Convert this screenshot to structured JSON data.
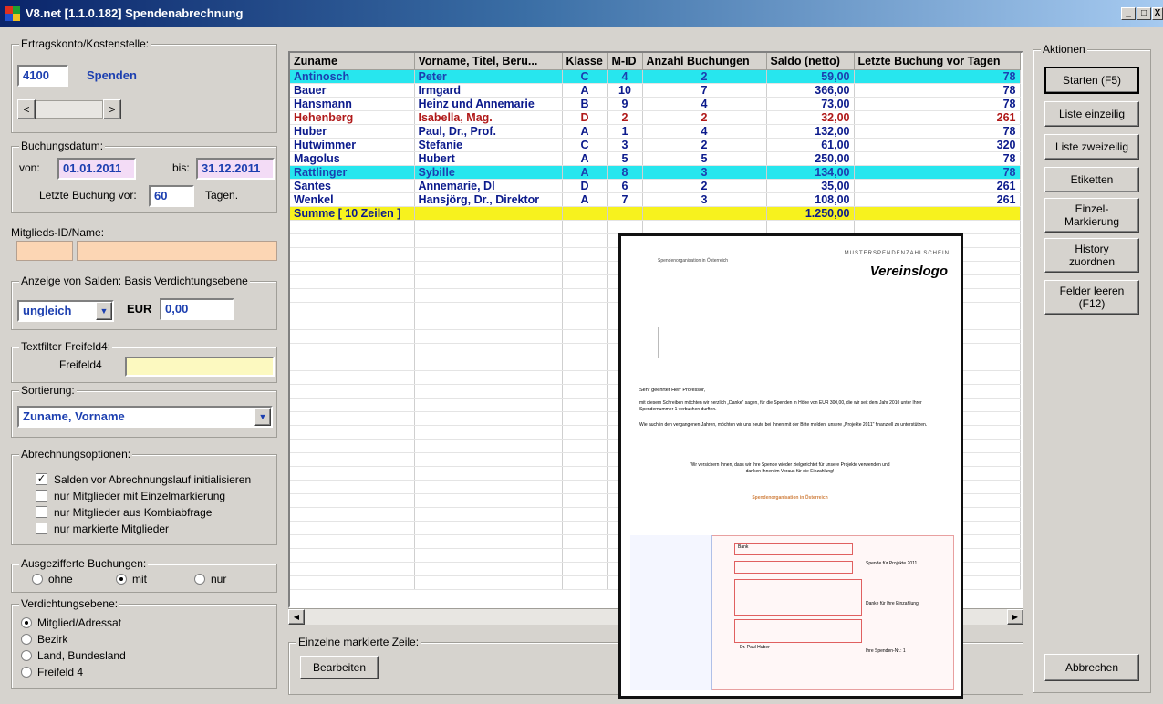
{
  "window": {
    "title": "V8.net [1.1.0.182] Spendenabrechnung",
    "min": "_",
    "max": "□",
    "close": "X"
  },
  "account": {
    "legend": "Ertragskonto/Kostenstelle:",
    "code": "4100",
    "name": "Spenden",
    "prev": "<",
    "next": ">"
  },
  "date": {
    "legend": "Buchungsdatum:",
    "von_label": "von:",
    "von": "01.01.2011",
    "bis_label": "bis:",
    "bis": "31.12.2011",
    "last_label": "Letzte Buchung vor:",
    "last_value": "60",
    "tage_label": "Tagen."
  },
  "member": {
    "label": "Mitglieds-ID/Name:"
  },
  "saldo": {
    "legend": "Anzeige von Salden: Basis Verdichtungsebene",
    "select": "ungleich",
    "currency": "EUR",
    "value": "0,00"
  },
  "textfilter": {
    "legend": "Textfilter Freifeld4:",
    "label": "Freifeld4"
  },
  "sort": {
    "legend": "Sortierung:",
    "value": "Zuname, Vorname"
  },
  "options": {
    "legend": "Abrechnungsoptionen:",
    "items": [
      "Salden vor Abrechnungslauf initialisieren",
      "nur Mitglieder mit Einzelmarkierung",
      "nur Mitglieder aus Kombiabfrage",
      "nur markierte Mitglieder"
    ]
  },
  "ausgeziffert": {
    "legend": "Ausgezifferte Buchungen:",
    "ohne": "ohne",
    "mit": "mit",
    "nur": "nur"
  },
  "verdichtung": {
    "legend": "Verdichtungsebene:",
    "items": [
      "Mitglied/Adressat",
      "Bezirk",
      "Land, Bundesland",
      "Freifeld 4"
    ]
  },
  "table": {
    "columns": [
      "Zuname",
      "Vorname, Titel, Beru...",
      "Klasse",
      "M-ID",
      "Anzahl Buchungen",
      "Saldo (netto)",
      "Letzte Buchung vor Tagen"
    ],
    "rows": [
      [
        "Antinosch",
        "Peter",
        "C",
        "4",
        "2",
        "59,00",
        "78"
      ],
      [
        "Bauer",
        "Irmgard",
        "A",
        "10",
        "7",
        "366,00",
        "78"
      ],
      [
        "Hansmann",
        "Heinz und Annemarie",
        "B",
        "9",
        "4",
        "73,00",
        "78"
      ],
      [
        "Hehenberg",
        "Isabella, Mag.",
        "D",
        "2",
        "2",
        "32,00",
        "261"
      ],
      [
        "Huber",
        "Paul, Dr., Prof.",
        "A",
        "1",
        "4",
        "132,00",
        "78"
      ],
      [
        "Hutwimmer",
        "Stefanie",
        "C",
        "3",
        "2",
        "61,00",
        "320"
      ],
      [
        "Magolus",
        "Hubert",
        "A",
        "5",
        "5",
        "250,00",
        "78"
      ],
      [
        "Rattlinger",
        "Sybille",
        "A",
        "8",
        "3",
        "134,00",
        "78"
      ],
      [
        "Santes",
        "Annemarie, DI",
        "D",
        "6",
        "2",
        "35,00",
        "261"
      ],
      [
        "Wenkel",
        "Hansjörg, Dr., Direktor",
        "A",
        "7",
        "3",
        "108,00",
        "261"
      ]
    ],
    "sum_label": "Summe [ 10 Zeilen ]",
    "sum_value": "1.250,00"
  },
  "bottom": {
    "legend": "Einzelne markierte Zeile:",
    "edit": "Bearbeiten"
  },
  "actions": {
    "legend": "Aktionen",
    "buttons": [
      "Starten (F5)",
      "Liste einzeilig",
      "Liste zweizeilig",
      "Etiketten",
      "Einzel-\nMarkierung",
      "History\nzuordnen",
      "Felder leeren\n(F12)"
    ],
    "cancel": "Abbrechen"
  },
  "letter": {
    "header_right": "MUSTERSPENDENZAHLSCHEIN",
    "logo": "Vereinslogo",
    "sender": "Spendenorganisation in Österreich",
    "greeting": "Sehr geehrter Herr Professor,",
    "body1": "mit diesem Schreiben möchten wir herzlich „Danke\" sagen, für die Spenden in Höhe von EUR 300,00, die wir seit dem Jahr 2010 unter Ihrer Spendernummer 1 verbuchen durften.",
    "body2": "Wie auch in den vergangenen Jahren, möchten wir uns heute bei Ihnen mit der Bitte melden, unsere „Projekte 2011\" finanziell zu unterstützen.",
    "closing": "Wir versichern Ihnen, dass wir Ihre Spende wieder zielgerichtet für unsere Projekte verwenden und danken Ihnen im Voraus für die Einzahlung!",
    "signature": "Spendenorganisation in Österreich",
    "slip_bank": "Bank",
    "slip_purpose": "Spende für Projekte 2011",
    "slip_thanks": "Danke für Ihre Einzahlung!",
    "slip_donor": "Dr. Paul Huber",
    "slip_number": "Ihre Spenden-Nr.: 1"
  }
}
